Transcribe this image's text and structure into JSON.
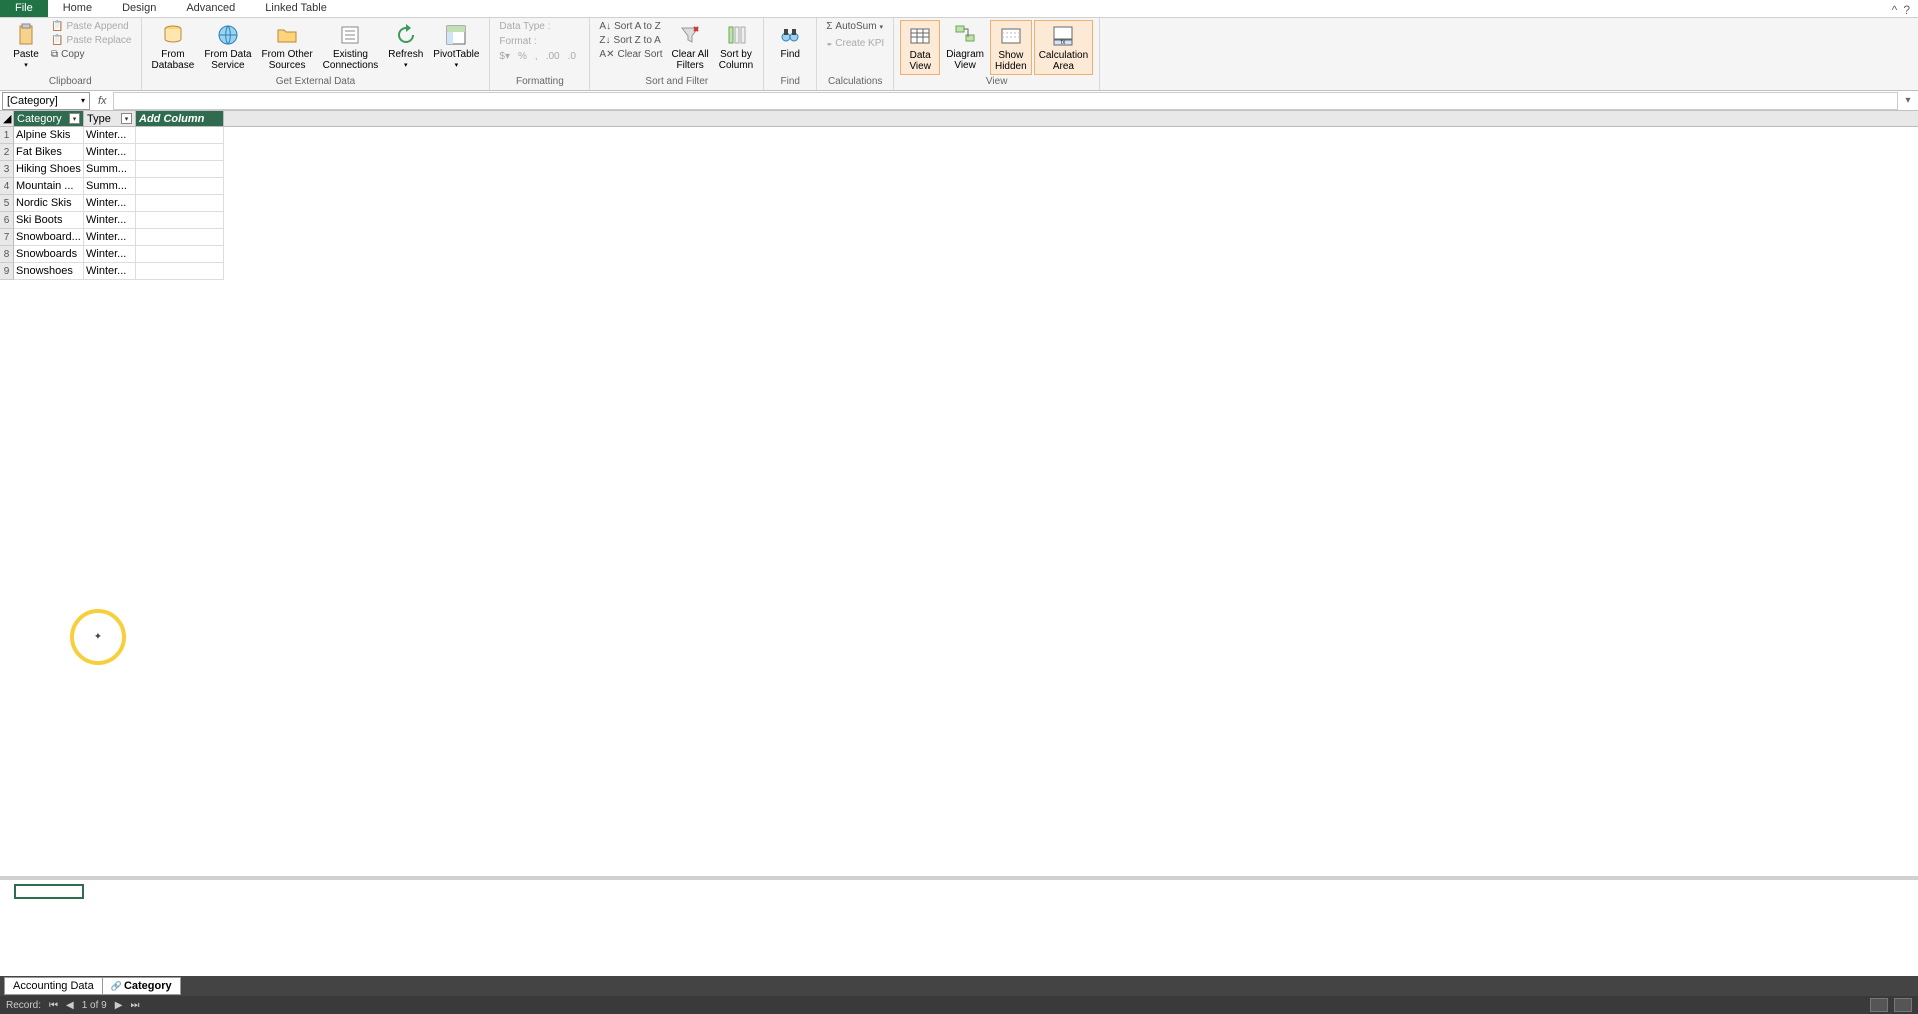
{
  "tabs": [
    "File",
    "Home",
    "Design",
    "Advanced",
    "Linked Table"
  ],
  "active_tab": 0,
  "ribbon": {
    "clipboard": {
      "paste": "Paste",
      "paste_append": "Paste Append",
      "paste_replace": "Paste Replace",
      "copy": "Copy",
      "label": "Clipboard"
    },
    "external": {
      "from_db": "From\nDatabase",
      "from_ds": "From Data\nService",
      "from_other": "From Other\nSources",
      "existing": "Existing\nConnections",
      "refresh": "Refresh",
      "pivot": "PivotTable",
      "label": "Get External Data"
    },
    "formatting": {
      "data_type": "Data Type :",
      "format": "Format :",
      "label": "Formatting"
    },
    "sort": {
      "az": "Sort A to Z",
      "za": "Sort Z to A",
      "clear_sort": "Clear Sort",
      "clear_filters": "Clear All\nFilters",
      "sort_by_col": "Sort by\nColumn",
      "label": "Sort and Filter"
    },
    "find": {
      "find": "Find",
      "label": "Find"
    },
    "calculations": {
      "autosum": "AutoSum",
      "create_kpi": "Create KPI",
      "label": "Calculations"
    },
    "view": {
      "data_view": "Data\nView",
      "diagram_view": "Diagram\nView",
      "show_hidden": "Show\nHidden",
      "calc_area": "Calculation\nArea",
      "label": "View"
    }
  },
  "name_box": "[Category]",
  "columns": {
    "category": "Category",
    "type": "Type",
    "add": "Add Column"
  },
  "rows": [
    {
      "n": "1",
      "category": "Alpine Skis",
      "type": "Winter..."
    },
    {
      "n": "2",
      "category": "Fat Bikes",
      "type": "Winter..."
    },
    {
      "n": "3",
      "category": "Hiking Shoes",
      "type": "Summ..."
    },
    {
      "n": "4",
      "category": "Mountain ...",
      "type": "Summ..."
    },
    {
      "n": "5",
      "category": "Nordic Skis",
      "type": "Winter..."
    },
    {
      "n": "6",
      "category": "Ski Boots",
      "type": "Winter..."
    },
    {
      "n": "7",
      "category": "Snowboard...",
      "type": "Winter..."
    },
    {
      "n": "8",
      "category": "Snowboards",
      "type": "Winter..."
    },
    {
      "n": "9",
      "category": "Snowshoes",
      "type": "Winter..."
    }
  ],
  "sheet_tabs": {
    "accounting": "Accounting Data",
    "category": "Category"
  },
  "status": {
    "record": "Record:",
    "pos": "1 of 9"
  }
}
